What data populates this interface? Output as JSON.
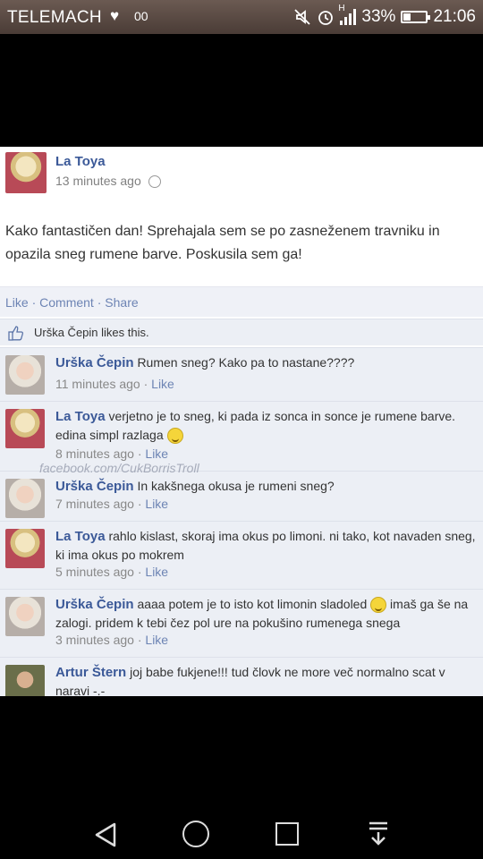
{
  "status_bar": {
    "carrier": "TELEMACH",
    "heart": "♥",
    "voicemail": "00",
    "battery": "33%",
    "time": "21:06",
    "signal_label": "H",
    "battery_level": 0.33
  },
  "post": {
    "author": "La Toya",
    "time": "13 minutes ago",
    "text": "Kako fantastičen dan! Sprehajala sem se po zasneženem travniku in opazila sneg rumene barve. Poskusila sem ga!",
    "actions": {
      "like": "Like",
      "sep1": "·",
      "comment": "Comment",
      "sep2": "·",
      "share": "Share"
    },
    "likes_text": "Urška Čepin likes this."
  },
  "comments": [
    {
      "author": "Urška Čepin",
      "text": "Rumen sneg? Kako pa to nastane????",
      "time": "11 minutes ago",
      "like": "Like",
      "avatar": "urska"
    },
    {
      "author": "La Toya",
      "text": "verjetno je to sneg, ki pada iz sonca in sonce je rumene barve. edina simpl razlaga",
      "time": "8 minutes ago",
      "like": "Like",
      "avatar": "latoya",
      "smiley": true
    },
    {
      "author": "Urška Čepin",
      "text": "In kakšnega okusa je rumeni sneg?",
      "time": "7 minutes ago",
      "like": "Like",
      "avatar": "urska"
    },
    {
      "author": "La Toya",
      "text": "rahlo kislast, skoraj ima okus po limoni. ni tako, kot navaden sneg, ki ima okus po mokrem",
      "time": "5 minutes ago",
      "like": "Like",
      "avatar": "latoya"
    },
    {
      "author": "Urška Čepin",
      "text": "aaaa potem je to isto kot limonin sladoled",
      "text2": "imaš ga še na zalogi. pridem k tebi čez pol ure na pokušino rumenega snega",
      "time": "3 minutes ago",
      "like": "Like",
      "avatar": "urska",
      "smiley_mid": true
    },
    {
      "author": "Artur Štern",
      "text": "joj babe fukjene!!! tud človk ne more več normalno scat v naravi -.-",
      "avatar": "artur"
    }
  ],
  "watermark": "facebook.com/CukBorrisTroll",
  "sep": "·",
  "colors": {
    "link": "#3b5998",
    "muted": "#888888",
    "panel": "#eceff5"
  },
  "icons": {
    "back": "back-triangle-icon",
    "home": "home-circle-icon",
    "recents": "recents-square-icon",
    "notifications": "notification-down-icon"
  }
}
